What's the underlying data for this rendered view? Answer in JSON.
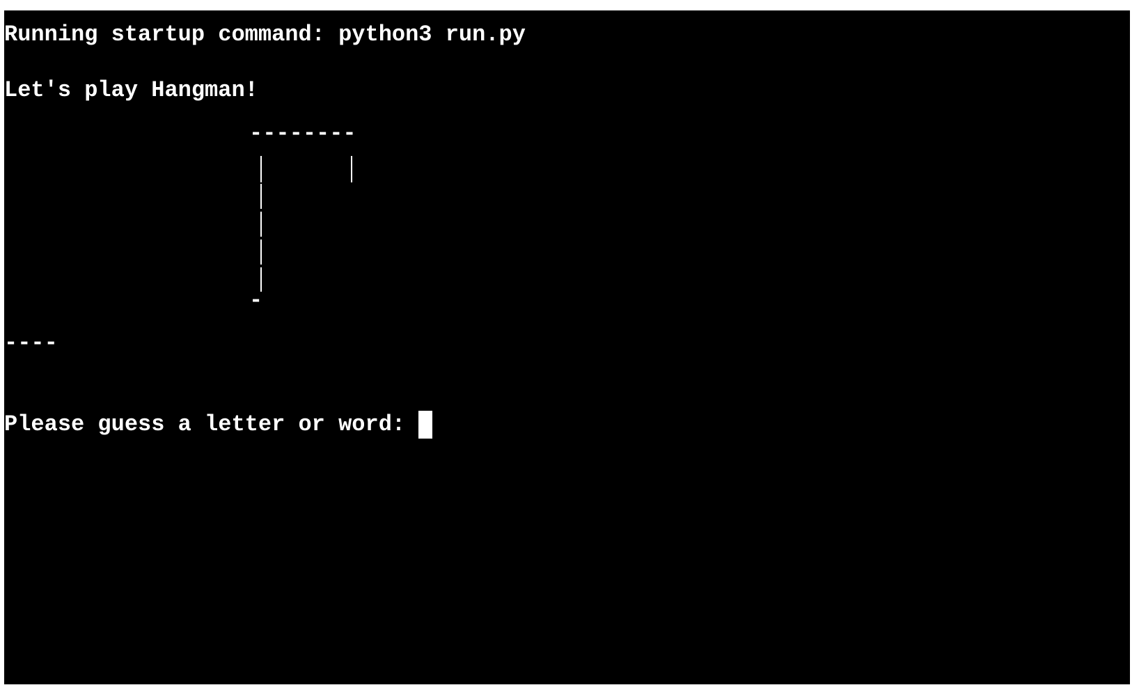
{
  "terminal": {
    "startup_line": "Running startup command: python3 run.py",
    "welcome_line": "Let's play Hangman!",
    "word_display": "----",
    "prompt": "Please guess a letter or word: ",
    "colors": {
      "background": "#000000",
      "foreground": "#ffffff"
    },
    "hangman_art": {
      "top_beam": "--------",
      "base": "-"
    }
  }
}
